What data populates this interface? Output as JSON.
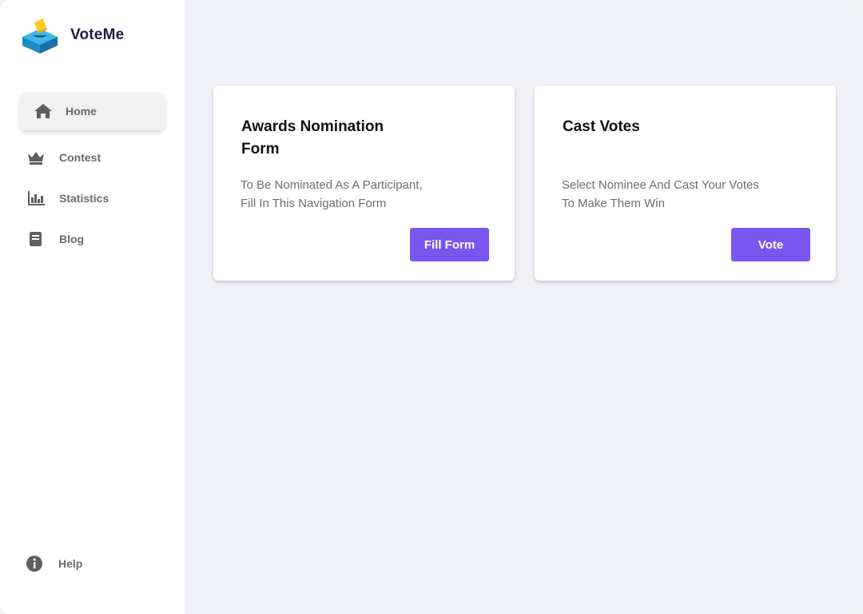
{
  "brand": {
    "name": "VoteMe",
    "icon": "ballot-box-icon"
  },
  "sidebar": {
    "items": [
      {
        "label": "Home",
        "icon": "home-icon",
        "active": true
      },
      {
        "label": "Contest",
        "icon": "crown-icon"
      },
      {
        "label": "Statistics",
        "icon": "bar-chart-icon"
      },
      {
        "label": "Blog",
        "icon": "book-icon"
      }
    ],
    "help": {
      "label": "Help",
      "icon": "info-icon"
    }
  },
  "cards": [
    {
      "title": "Awards Nomination Form",
      "description": "To Be Nominated As A Participant,\nFill In This Navigation Form",
      "button": "Fill Form"
    },
    {
      "title": "Cast Votes",
      "description": "Select Nominee And  Cast Your Votes\nTo Make Them Win",
      "button": "Vote"
    }
  ],
  "colors": {
    "accent": "#7a56ef",
    "background": "#f0f1f6",
    "icon": "#5f5f5f"
  }
}
